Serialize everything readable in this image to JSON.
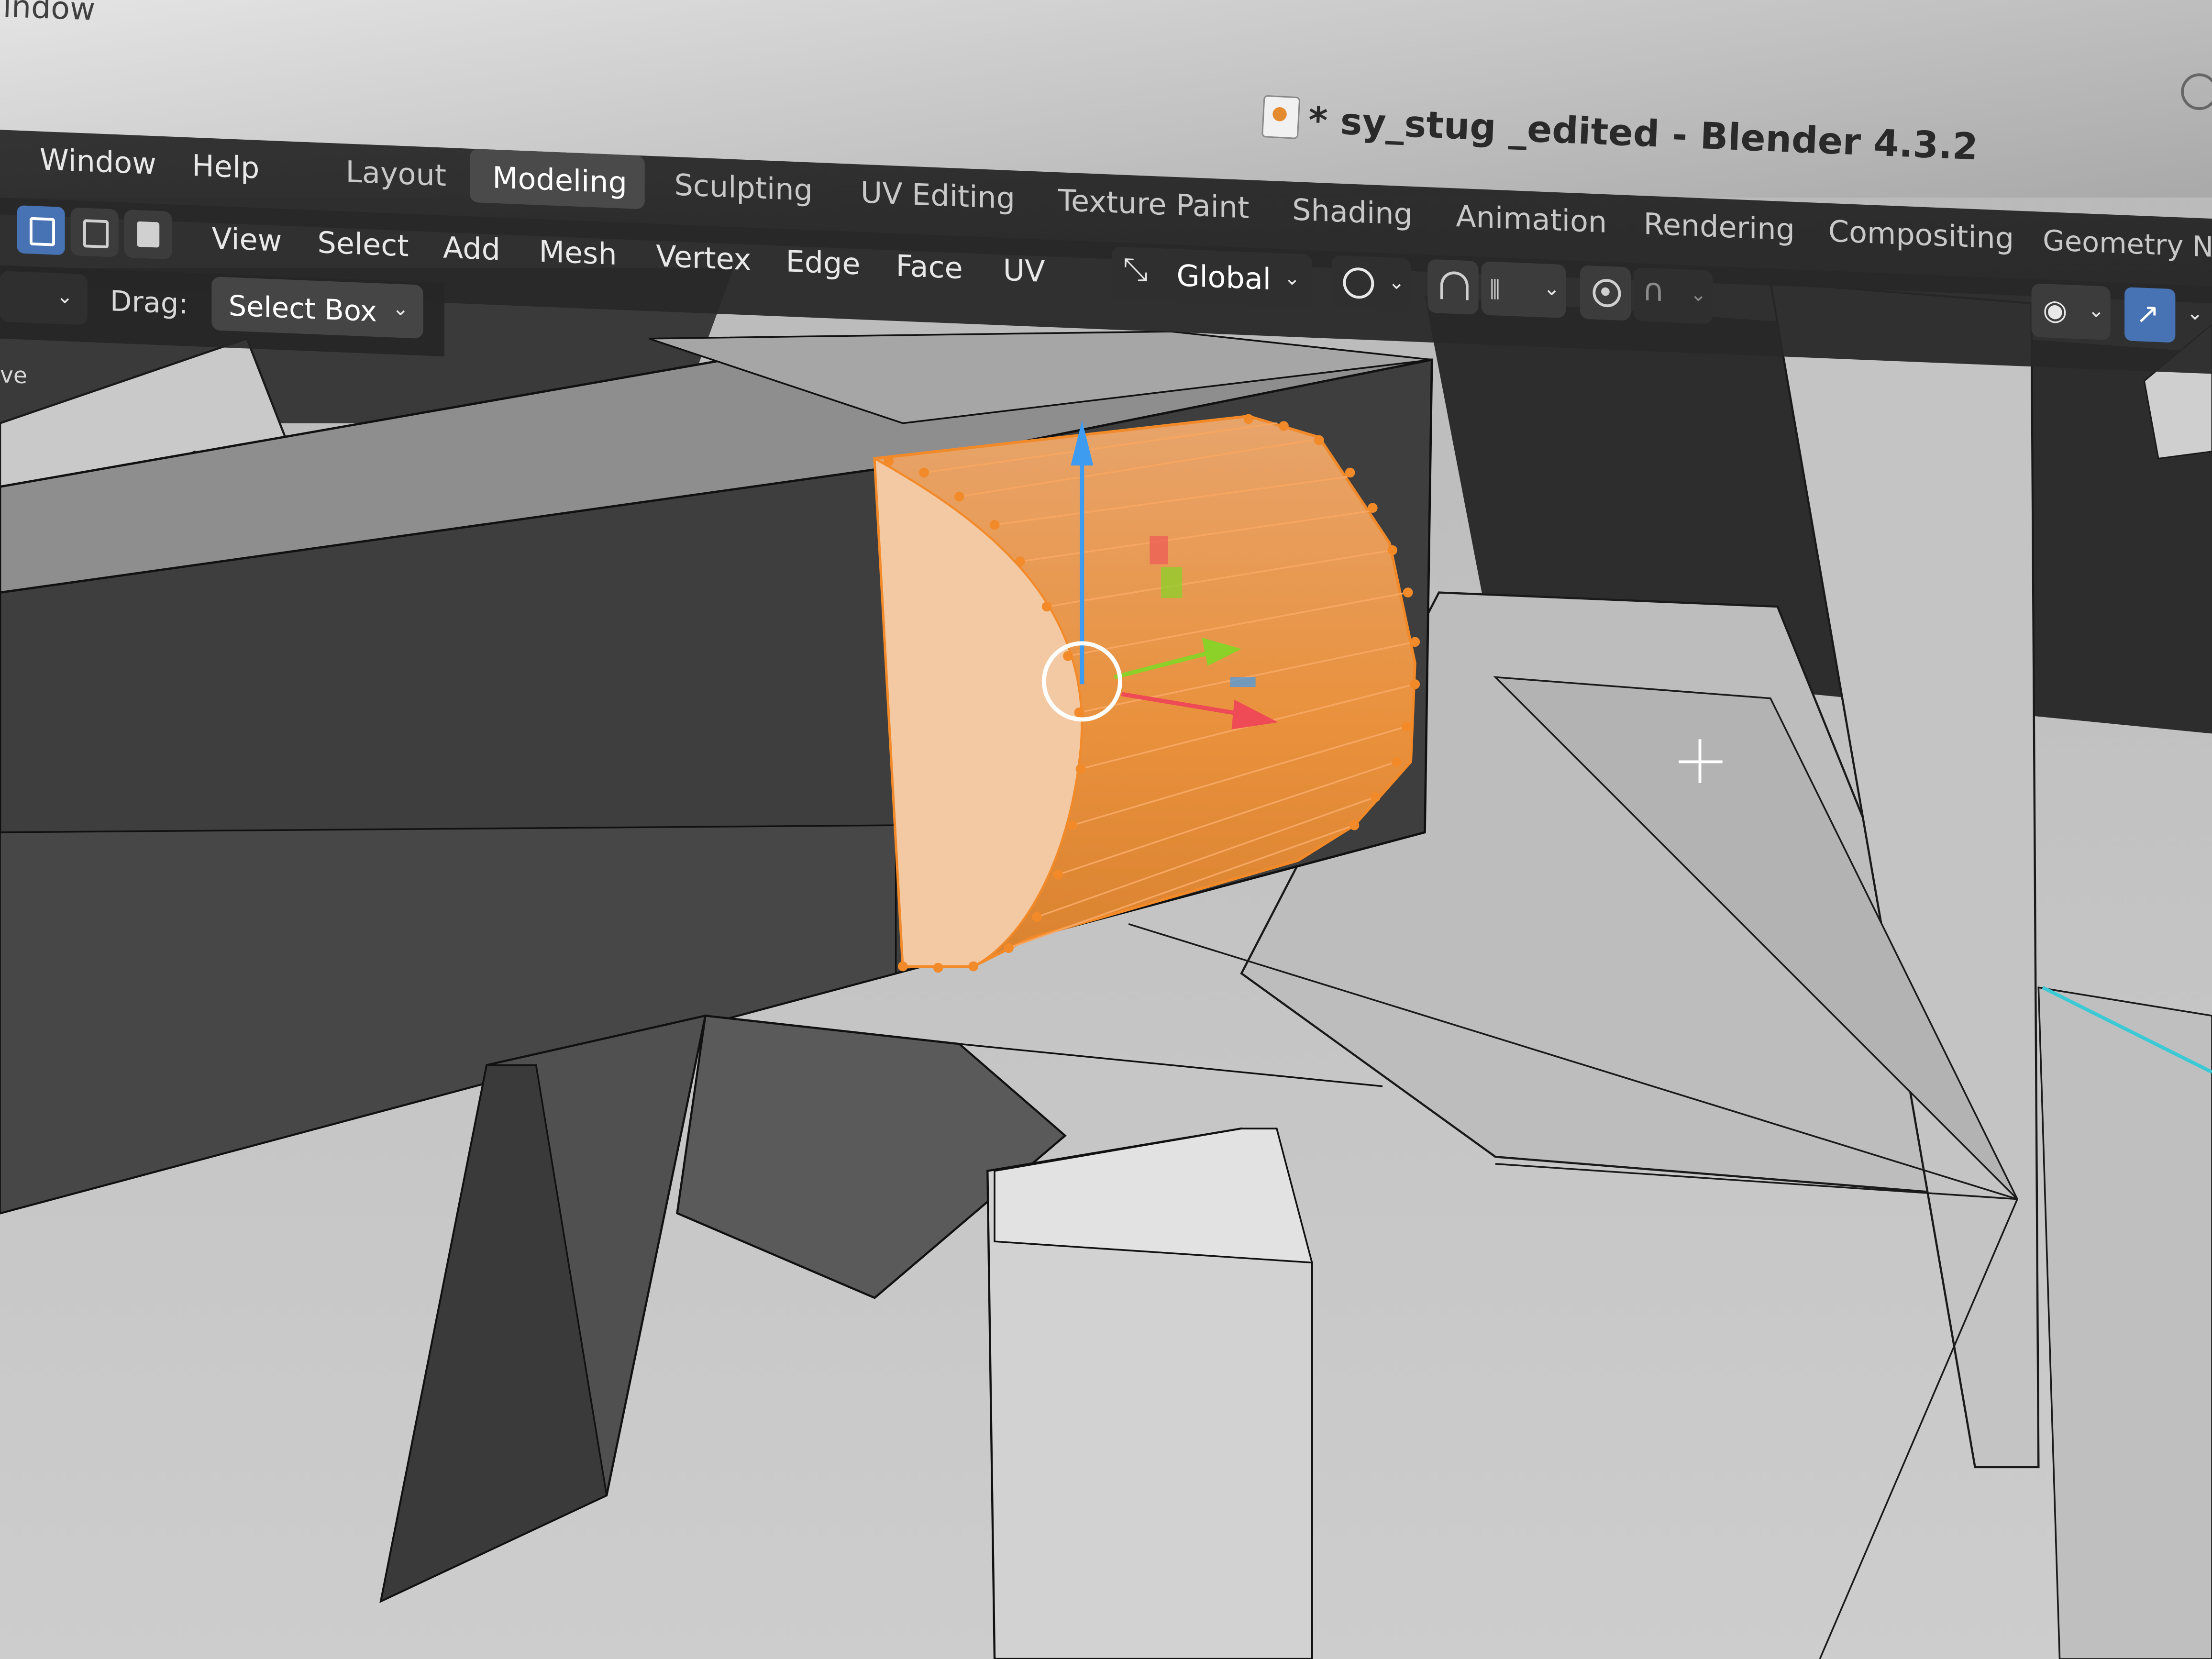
{
  "window": {
    "corner_label": "indow",
    "title": "* sy_stug _edited - Blender 4.3.2"
  },
  "menubar": {
    "items": [
      "Window",
      "Help"
    ]
  },
  "workspace_tabs": [
    "Layout",
    "Modeling",
    "Sculpting",
    "UV Editing",
    "Texture Paint",
    "Shading",
    "Animation",
    "Rendering",
    "Compositing",
    "Geometry No"
  ],
  "active_workspace": "Modeling",
  "editmode_menu": [
    "View",
    "Select",
    "Add",
    "Mesh",
    "Vertex",
    "Edge",
    "Face",
    "UV"
  ],
  "select_mode": {
    "options": [
      "vertex-select-mode-icon",
      "edge-select-mode-icon",
      "face-select-mode-icon"
    ],
    "active": "vertex-select-mode-icon"
  },
  "tool_settings": {
    "drag_label": "Drag:",
    "drag_value": "Select Box"
  },
  "transform_orientation": "Global",
  "side_clip": "ve",
  "colors": {
    "selection": "#f28a2a",
    "gizmo_x": "#ee4b56",
    "gizmo_y": "#8bd12a",
    "gizmo_z": "#3d9bf0",
    "accent_blue": "#4772b3"
  }
}
